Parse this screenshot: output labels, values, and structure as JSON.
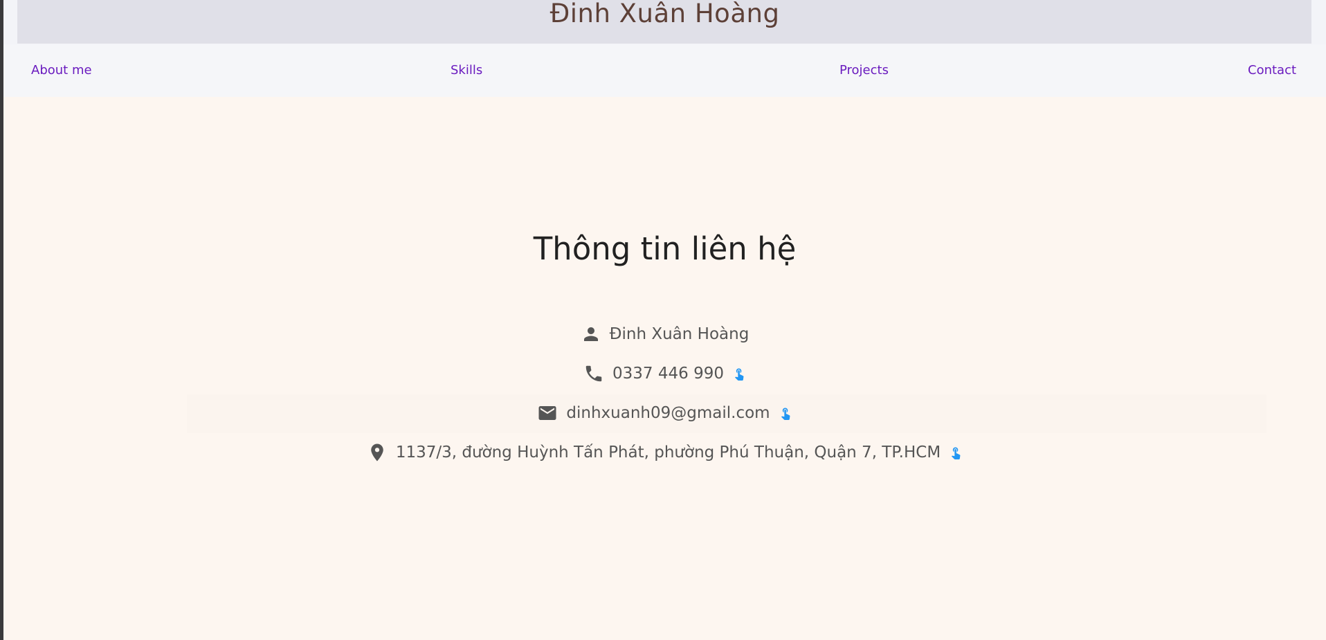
{
  "header": {
    "title": "Đinh Xuân Hoàng"
  },
  "nav": {
    "items": [
      {
        "label": "About me"
      },
      {
        "label": "Skills"
      },
      {
        "label": "Projects"
      },
      {
        "label": "Contact"
      }
    ]
  },
  "contact": {
    "title": "Thông tin liên hệ",
    "name": {
      "icon": "person-icon",
      "text": "Đinh Xuân Hoàng"
    },
    "phone": {
      "icon": "phone-icon",
      "text": "0337 446 990",
      "action_icon": "tap-icon"
    },
    "email": {
      "icon": "email-icon",
      "text": "dinhxuanh09@gmail.com",
      "action_icon": "tap-icon"
    },
    "address": {
      "icon": "location-pin-icon",
      "text": "1137/3, đường Huỳnh Tấn Phát, phường Phú Thuận, Quận 7, TP.HCM",
      "action_icon": "tap-icon"
    }
  },
  "colors": {
    "title": "#5d4037",
    "nav_link": "#6a1bbf",
    "page_bg": "#fdf6f0",
    "tap_icon": "#2196f3",
    "body_text": "#555555"
  }
}
